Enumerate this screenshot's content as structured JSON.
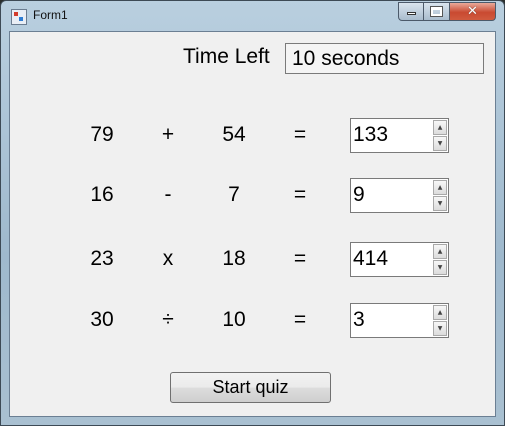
{
  "window": {
    "title": "Form1"
  },
  "timer": {
    "label": "Time Left",
    "value": "10 seconds"
  },
  "rows": [
    {
      "left": "79",
      "op": "+",
      "right": "54",
      "eq": "=",
      "answer": "133"
    },
    {
      "left": "16",
      "op": "-",
      "right": "7",
      "eq": "=",
      "answer": "9"
    },
    {
      "left": "23",
      "op": "x",
      "right": "18",
      "eq": "=",
      "answer": "414"
    },
    {
      "left": "30",
      "op": "÷",
      "right": "10",
      "eq": "=",
      "answer": "3"
    }
  ],
  "start_button": {
    "label": "Start quiz"
  },
  "colors": {
    "close_button": "#c94a31",
    "client_bg": "#f0f0f0"
  }
}
